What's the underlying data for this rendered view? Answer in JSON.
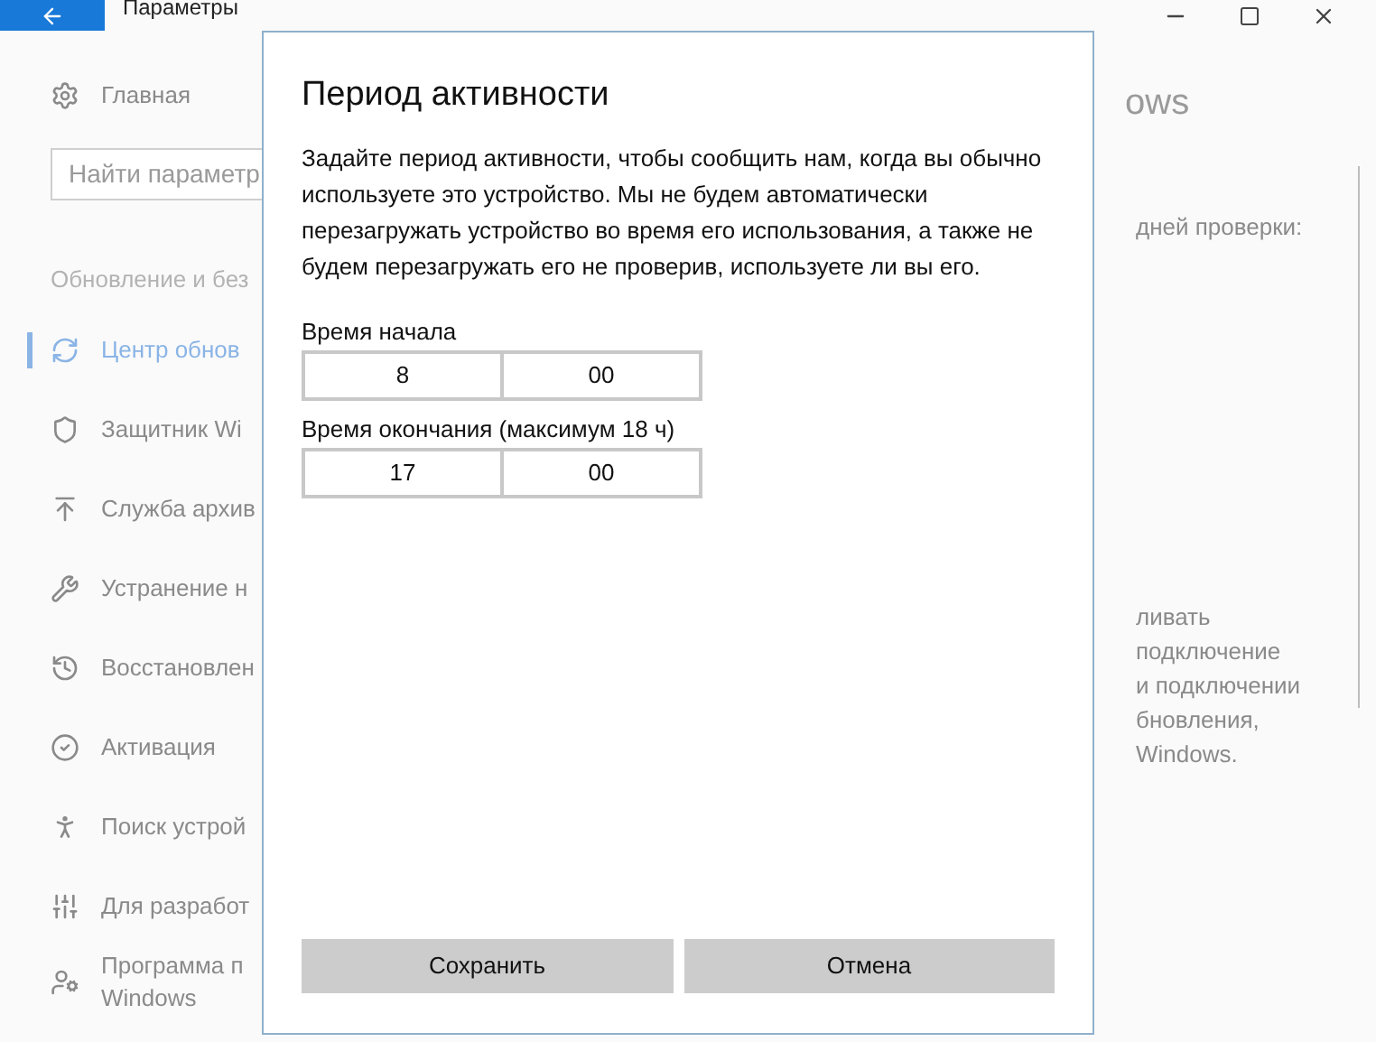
{
  "window": {
    "title": "Параметры"
  },
  "sidebar": {
    "home": "Главная",
    "search": {
      "placeholder": "Найти параметр"
    },
    "section": "Обновление и без",
    "items": [
      {
        "label": "Центр обнов",
        "selected": true
      },
      {
        "label": "Защитник Wi",
        "selected": false
      },
      {
        "label": "Служба архив",
        "selected": false
      },
      {
        "label": "Устранение н",
        "selected": false
      },
      {
        "label": "Восстановлен",
        "selected": false
      },
      {
        "label": "Активация",
        "selected": false
      },
      {
        "label": "Поиск устрой",
        "selected": false
      },
      {
        "label": "Для разработ",
        "selected": false
      },
      {
        "label": "Программа п\nWindows",
        "selected": false
      }
    ]
  },
  "content": {
    "heading": "ows",
    "status": "дней проверки:",
    "paragraph_lines": [
      "ливать",
      "подключение",
      "и подключении",
      "бновления,",
      "Windows."
    ]
  },
  "dialog": {
    "title": "Период активности",
    "text": "Задайте период активности, чтобы сообщить нам, когда вы обычно используете это устройство. Мы не будем автоматически перезагружать устройство во время его использования, а также не будем перезагружать его не проверив, используете ли вы его.",
    "fields": [
      {
        "label": "Время начала",
        "hours": "8",
        "minutes": "00"
      },
      {
        "label": "Время окончания (максимум 18 ч)",
        "hours": "17",
        "minutes": "00"
      }
    ],
    "buttons": [
      "Сохранить",
      "Отмена"
    ]
  }
}
